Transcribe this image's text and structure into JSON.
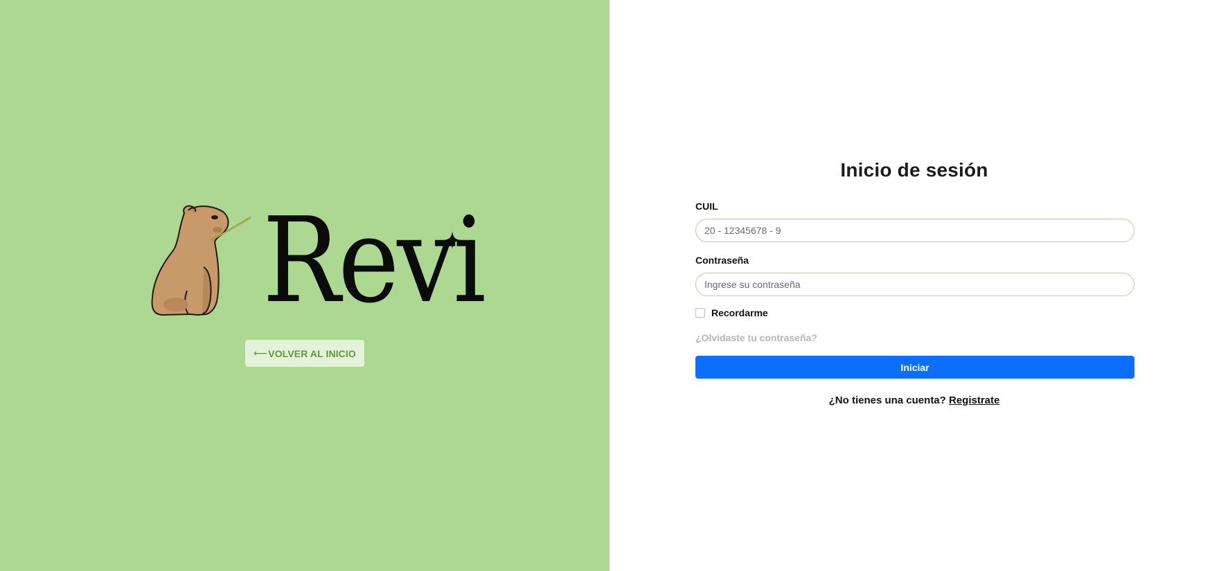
{
  "brand": {
    "wordmark": "Revi",
    "accent_color": "#add892"
  },
  "left": {
    "back_arrow": "⟵",
    "back_label": "VOLVER AL INICIO"
  },
  "login": {
    "title": "Inicio de sesión",
    "cuil_label": "CUIL",
    "cuil_placeholder": "20 - 12345678 - 9",
    "password_label": "Contraseña",
    "password_placeholder": "Ingrese su contraseña",
    "remember_label": "Recordarme",
    "forgot_label": "¿Olvidaste tu contraseña?",
    "submit_label": "Iniciar",
    "submit_color": "#0d6efd",
    "no_account_text": "¿No tienes una cuenta?",
    "register_label": "Registrate"
  }
}
